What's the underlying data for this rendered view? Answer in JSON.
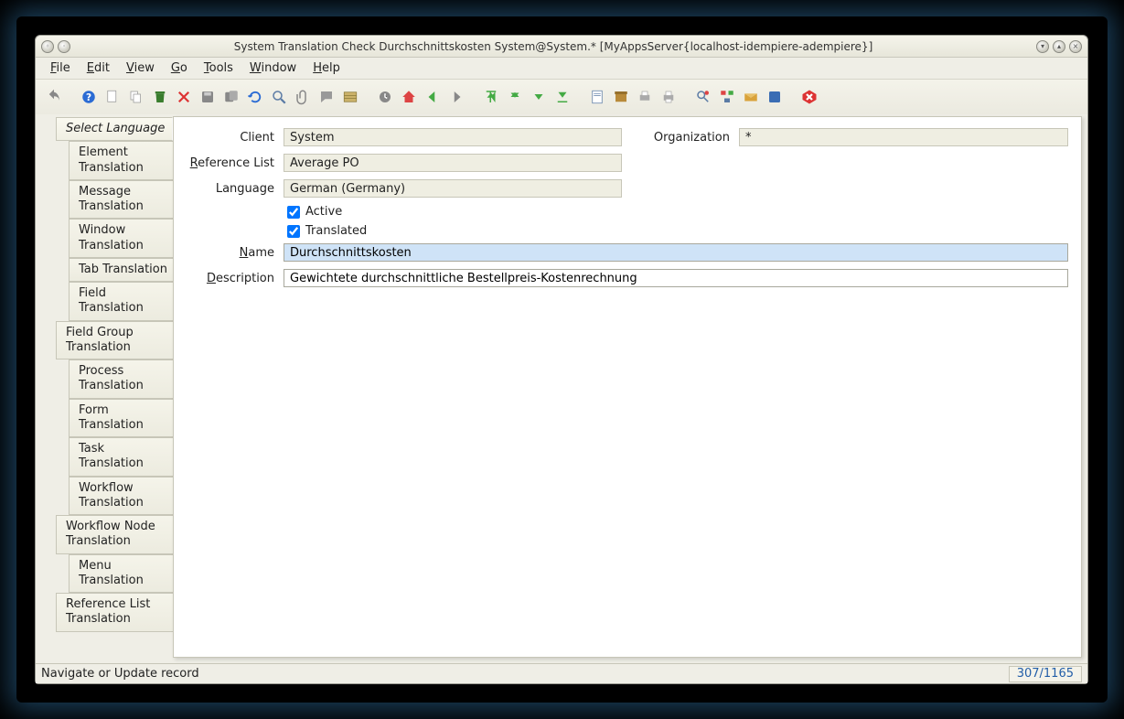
{
  "window": {
    "title": "System Translation Check  Durchschnittskosten  System@System.* [MyAppsServer{localhost-idempiere-adempiere}]"
  },
  "menu": {
    "file": "File",
    "edit": "Edit",
    "view": "View",
    "go": "Go",
    "tools": "Tools",
    "window": "Window",
    "help": "Help"
  },
  "toolbar_icons": [
    "undo-icon",
    "sep",
    "help-icon",
    "new-icon",
    "copy-icon",
    "delete-icon",
    "delete-selection-icon",
    "save-icon",
    "save-create-icon",
    "refresh-icon",
    "search-icon",
    "attach-icon",
    "chat-icon",
    "gridtoggle-icon",
    "sep",
    "history-icon",
    "home-icon",
    "back-icon",
    "forward-icon",
    "sep",
    "first-icon",
    "prev-icon",
    "next-icon",
    "last-icon",
    "sep",
    "report-icon",
    "archive-icon",
    "print-preview-icon",
    "print-icon",
    "sep",
    "zoom-across-icon",
    "workflow-icon",
    "request-icon",
    "product-info-icon",
    "sep",
    "close-icon"
  ],
  "sidebar": {
    "items": [
      {
        "label": "Select Language",
        "selected": true,
        "indent": 1
      },
      {
        "label": "Element Translation",
        "indent": 2
      },
      {
        "label": "Message Translation",
        "indent": 2
      },
      {
        "label": "Window Translation",
        "indent": 2
      },
      {
        "label": "Tab Translation",
        "indent": 2
      },
      {
        "label": "Field Translation",
        "indent": 2
      },
      {
        "label": "Field Group Translation",
        "indent": 1
      },
      {
        "label": "Process Translation",
        "indent": 2
      },
      {
        "label": "Form Translation",
        "indent": 2
      },
      {
        "label": "Task Translation",
        "indent": 2
      },
      {
        "label": "Workflow Translation",
        "indent": 2
      },
      {
        "label": "Workflow Node Translation",
        "indent": 1
      },
      {
        "label": "Menu Translation",
        "indent": 2
      },
      {
        "label": "Reference List Translation",
        "indent": 1
      }
    ]
  },
  "form": {
    "client_label": "Client",
    "client_value": "System",
    "org_label": "Organization",
    "org_value": "*",
    "reflist_label": "Reference List",
    "reflist_value": "Average PO",
    "language_label": "Language",
    "language_value": "German (Germany)",
    "active_label": "Active",
    "active_checked": true,
    "translated_label": "Translated",
    "translated_checked": true,
    "name_label": "Name",
    "name_value": "Durchschnittskosten",
    "desc_label": "Description",
    "desc_value": "Gewichtete durchschnittliche Bestellpreis-Kostenrechnung"
  },
  "status": {
    "message": "Navigate or Update record",
    "counter": "307/1165"
  }
}
